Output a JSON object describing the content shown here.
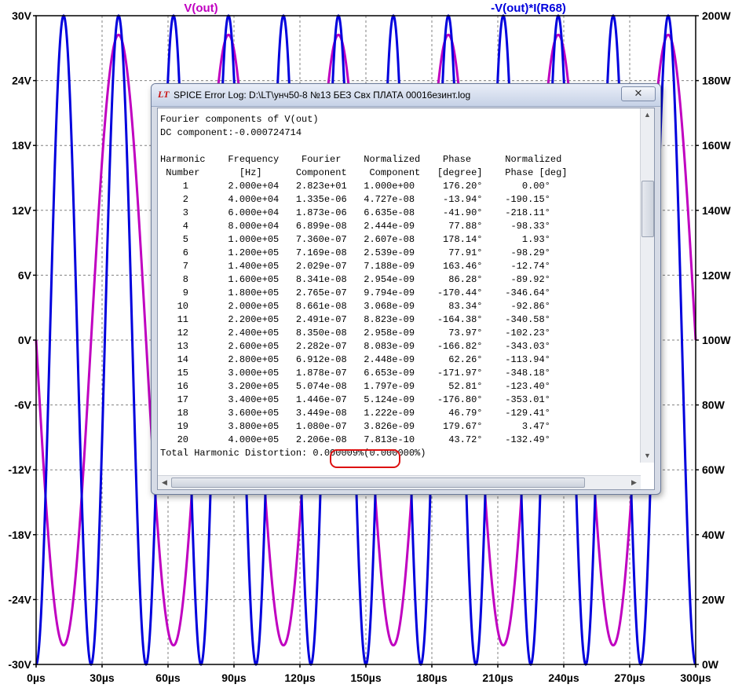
{
  "plot": {
    "trace1_label": "V(out)",
    "trace2_label": "-V(out)*I(R68)",
    "colors": {
      "trace1": "#c000c0",
      "trace2": "#0000dd",
      "grid": "#808080",
      "axis": "#000000"
    },
    "left_ticks": [
      "30V",
      "24V",
      "18V",
      "12V",
      "6V",
      "0V",
      "-6V",
      "-12V",
      "-18V",
      "-24V",
      "-30V"
    ],
    "right_ticks": [
      "200W",
      "180W",
      "160W",
      "140W",
      "120W",
      "100W",
      "80W",
      "60W",
      "40W",
      "20W",
      "0W"
    ],
    "x_ticks": [
      "0µs",
      "30µs",
      "60µs",
      "90µs",
      "120µs",
      "150µs",
      "180µs",
      "210µs",
      "240µs",
      "270µs",
      "300µs"
    ]
  },
  "chart_data": {
    "type": "line",
    "x_unit": "µs",
    "xlim": [
      0,
      300
    ],
    "ylim_left": [
      -30,
      30
    ],
    "ylim_right": [
      0,
      200
    ],
    "grid": true,
    "series": [
      {
        "name": "V(out)",
        "axis": "left",
        "shape": "sine",
        "frequency_hz": 20000,
        "amplitude": 28.23,
        "dc": 0,
        "start": "falling from 0V at 0µs"
      },
      {
        "name": "-V(out)*I(R68)",
        "axis": "right",
        "shape": "sin-squared",
        "frequency_hz": 40000,
        "min": 0,
        "max": 200
      }
    ]
  },
  "log_window": {
    "title": "SPICE Error Log: D:\\LT\\унч50-8  №13  БЕЗ Свх ПЛАТА 00016езинт.log",
    "close_symbol": "✕",
    "app_icon": "LT",
    "scroll_up": "▲",
    "scroll_down": "▼",
    "scroll_left": "◀",
    "scroll_right": "▶",
    "text": "Fourier components of V(out)\nDC component:-0.000724714\n\nHarmonic    Frequency    Fourier    Normalized    Phase      Normalized\n Number       [Hz]      Component    Component   [degree]    Phase [deg]\n    1       2.000e+04   2.823e+01   1.000e+00     176.20°       0.00°\n    2       4.000e+04   1.335e-06   4.727e-08     -13.94°    -190.15°\n    3       6.000e+04   1.873e-06   6.635e-08     -41.90°    -218.11°\n    4       8.000e+04   6.899e-08   2.444e-09      77.88°     -98.33°\n    5       1.000e+05   7.360e-07   2.607e-08     178.14°       1.93°\n    6       1.200e+05   7.169e-08   2.539e-09      77.91°     -98.29°\n    7       1.400e+05   2.029e-07   7.188e-09     163.46°     -12.74°\n    8       1.600e+05   8.341e-08   2.954e-09      86.28°     -89.92°\n    9       1.800e+05   2.765e-07   9.794e-09    -170.44°    -346.64°\n   10       2.000e+05   8.661e-08   3.068e-09      83.34°     -92.86°\n   11       2.200e+05   2.491e-07   8.823e-09    -164.38°    -340.58°\n   12       2.400e+05   8.350e-08   2.958e-09      73.97°    -102.23°\n   13       2.600e+05   2.282e-07   8.083e-09    -166.82°    -343.03°\n   14       2.800e+05   6.912e-08   2.448e-09      62.26°    -113.94°\n   15       3.000e+05   1.878e-07   6.653e-09    -171.97°    -348.18°\n   16       3.200e+05   5.074e-08   1.797e-09      52.81°    -123.40°\n   17       3.400e+05   1.446e-07   5.124e-09    -176.80°    -353.01°\n   18       3.600e+05   3.449e-08   1.222e-09      46.79°    -129.41°\n   19       3.800e+05   1.080e-07   3.826e-09     179.67°       3.47°\n   20       4.000e+05   2.206e-08   7.813e-10      43.72°    -132.49°\nTotal Harmonic Distortion: 0.000009%(0.000000%)"
  }
}
